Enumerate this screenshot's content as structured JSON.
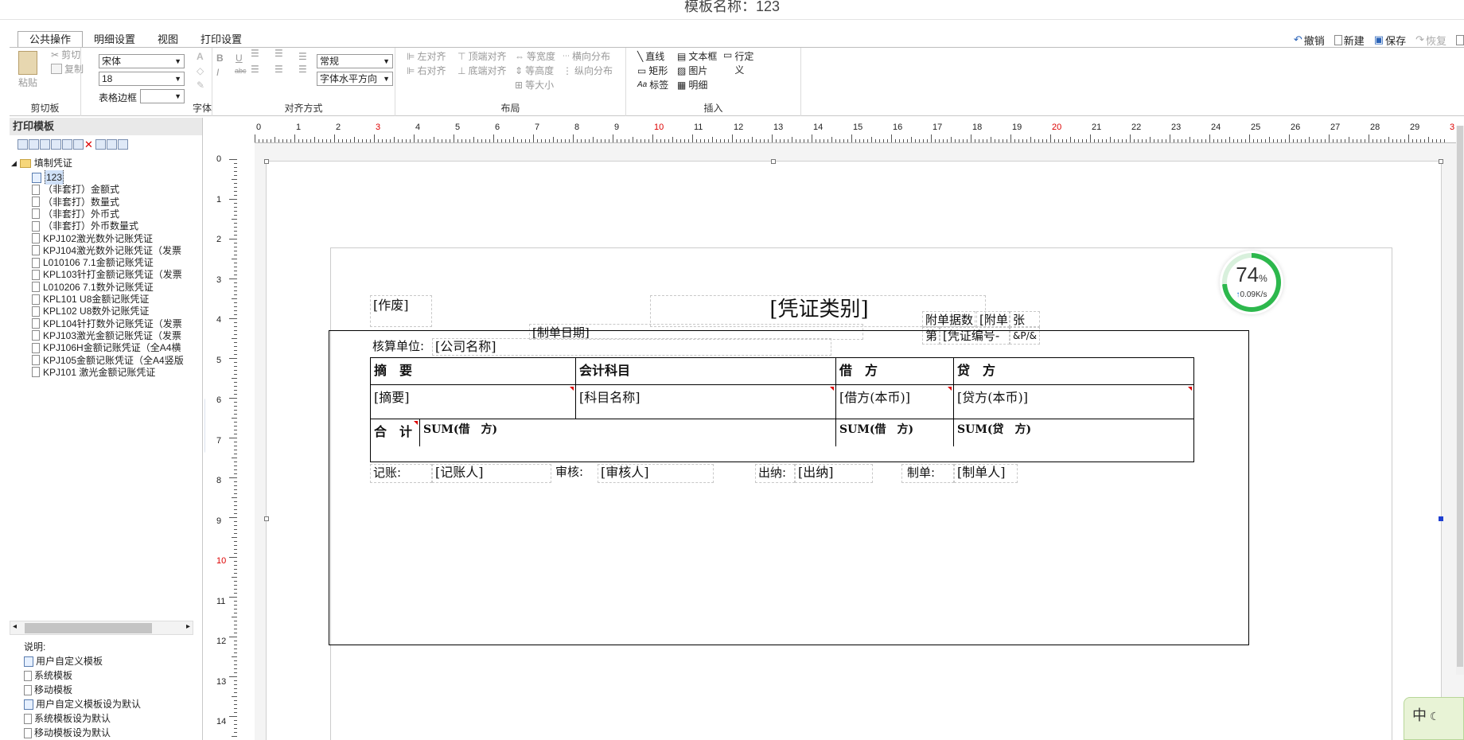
{
  "window_title": "模板名称：123",
  "tabs": [
    "公共操作",
    "明细设置",
    "视图",
    "打印设置"
  ],
  "active_tab": "公共操作",
  "right_tools": {
    "undo": "撤销",
    "new": "新建",
    "save": "保存",
    "redo": "恢复"
  },
  "ribbon": {
    "clipboard": {
      "paste": "粘贴",
      "cut": "剪切",
      "copy": "复制",
      "label": "剪切板"
    },
    "font": {
      "name": "宋体",
      "size": "18",
      "border_label": "表格边框",
      "label": "字体",
      "bold": "B",
      "italic": "I",
      "underline": "U",
      "strike": "abc"
    },
    "align": {
      "style": "常规",
      "halign": "字体水平方向",
      "label": "对齐方式"
    },
    "layout": {
      "left": "左对齐",
      "right": "右对齐",
      "top": "顶端对齐",
      "bottom": "底端对齐",
      "samewidth": "等宽度",
      "sameheight": "等高度",
      "samesize": "等大小",
      "hdist": "横向分布",
      "vdist": "纵向分布",
      "label": "布局"
    },
    "insert": {
      "line": "直线",
      "textbox": "文本框",
      "rowdef": "行定义",
      "rect": "矩形",
      "image": "图片",
      "label_item": "标签",
      "detail": "明细",
      "label": "插入"
    }
  },
  "left_panel": {
    "header": "打印模板",
    "root": "填制凭证",
    "items": [
      "123",
      "（非套打）金额式",
      "（非套打）数量式",
      "（非套打）外币式",
      "（非套打）外币数量式",
      "KPJ102激光数外记账凭证",
      "KPJ104激光数外记账凭证（发票",
      "L010106 7.1金额记账凭证",
      "KPL103针打金额记账凭证（发票",
      "L010206 7.1数外记账凭证",
      "KPL101 U8金额记账凭证",
      "KPL102 U8数外记账凭证",
      "KPL104针打数外记账凭证（发票",
      "KPJ103激光金额记账凭证（发票",
      "KPJ106H金额记账凭证（全A4横",
      "KPJ105金额记账凭证（全A4竖版",
      "KPJ101 激光金额记账凭证"
    ],
    "legend_title": "说明:",
    "legend": [
      "用户自定义模板",
      "系统模板",
      "移动模板",
      "用户自定义模板设为默认",
      "系统模板设为默认",
      "移动模板设为默认"
    ]
  },
  "ruler_top": [
    "0",
    "1",
    "2",
    "3",
    "4",
    "5",
    "6",
    "7",
    "8",
    "9",
    "10",
    "11",
    "12",
    "13",
    "14",
    "15",
    "16",
    "17",
    "18",
    "19",
    "20",
    "21",
    "22",
    "23",
    "24",
    "25",
    "26",
    "27",
    "28",
    "29",
    "3"
  ],
  "ruler_left": [
    "0",
    "1",
    "2",
    "3",
    "4",
    "5",
    "6",
    "7",
    "8",
    "9",
    "10",
    "11",
    "12",
    "13",
    "14"
  ],
  "voucher": {
    "void": "[作废]",
    "type": "[凭证类别]",
    "date": "[制单日期]",
    "attach1": "附单据数",
    "attach2": "[附单",
    "attach3": "张",
    "no1": "第",
    "no2": "[凭证编号-",
    "no3": "&P/&",
    "unit_label": "核算单位:",
    "unit_value": "[公司名称]",
    "headers": [
      "摘　要",
      "会计科目",
      "借　方",
      "贷　方"
    ],
    "row": [
      "[摘要]",
      "[科目名称]",
      "[借方(本币)]",
      "[贷方(本币)]"
    ],
    "total_label": "合　计",
    "total_sum": "SUM(借　方)",
    "total_debit": "SUM(借　方)",
    "total_credit": "SUM(贷　方)",
    "footer": {
      "bookkeeper_label": "记账:",
      "bookkeeper": "[记账人]",
      "reviewer_label": "审核:",
      "reviewer": "[审核人]",
      "cashier_label": "出纳:",
      "cashier": "[出纳]",
      "maker_label": "制单:",
      "maker": "[制单人]"
    }
  },
  "speed": {
    "percent": "74",
    "unit": "%",
    "rate": "0.09K/s"
  },
  "ime": "中"
}
